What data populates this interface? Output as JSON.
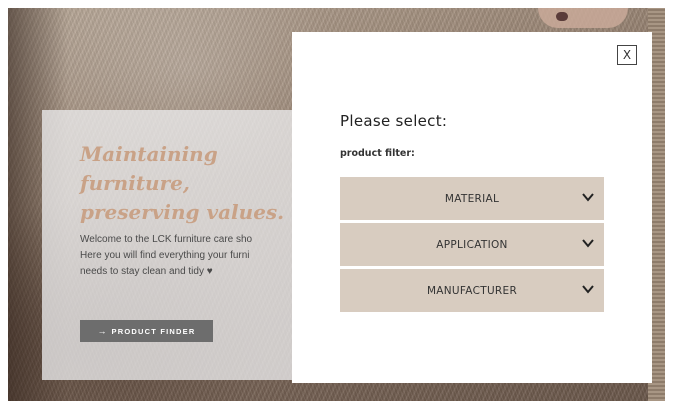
{
  "hero": {
    "title": "Maintaining furniture,\npreserving values.",
    "text": "Welcome to the LCK furniture care sho\nHere you will find everything your furni\nneeds to stay clean and tidy ♥",
    "button_arrow": "→",
    "button_label": "PRODUCT FINDER"
  },
  "modal": {
    "close_label": "X",
    "heading": "Please select:",
    "subheading": "product filter:",
    "filters": [
      {
        "label": "MATERIAL",
        "icon": "chevron-down-icon"
      },
      {
        "label": "APPLICATION",
        "icon": "chevron-down-icon"
      },
      {
        "label": "MANUFACTURER",
        "icon": "chevron-down-icon"
      }
    ]
  },
  "colors": {
    "accent_title": "#c9a287",
    "filter_bg": "#d8ccc0",
    "button_bg": "#6d6d6d"
  }
}
